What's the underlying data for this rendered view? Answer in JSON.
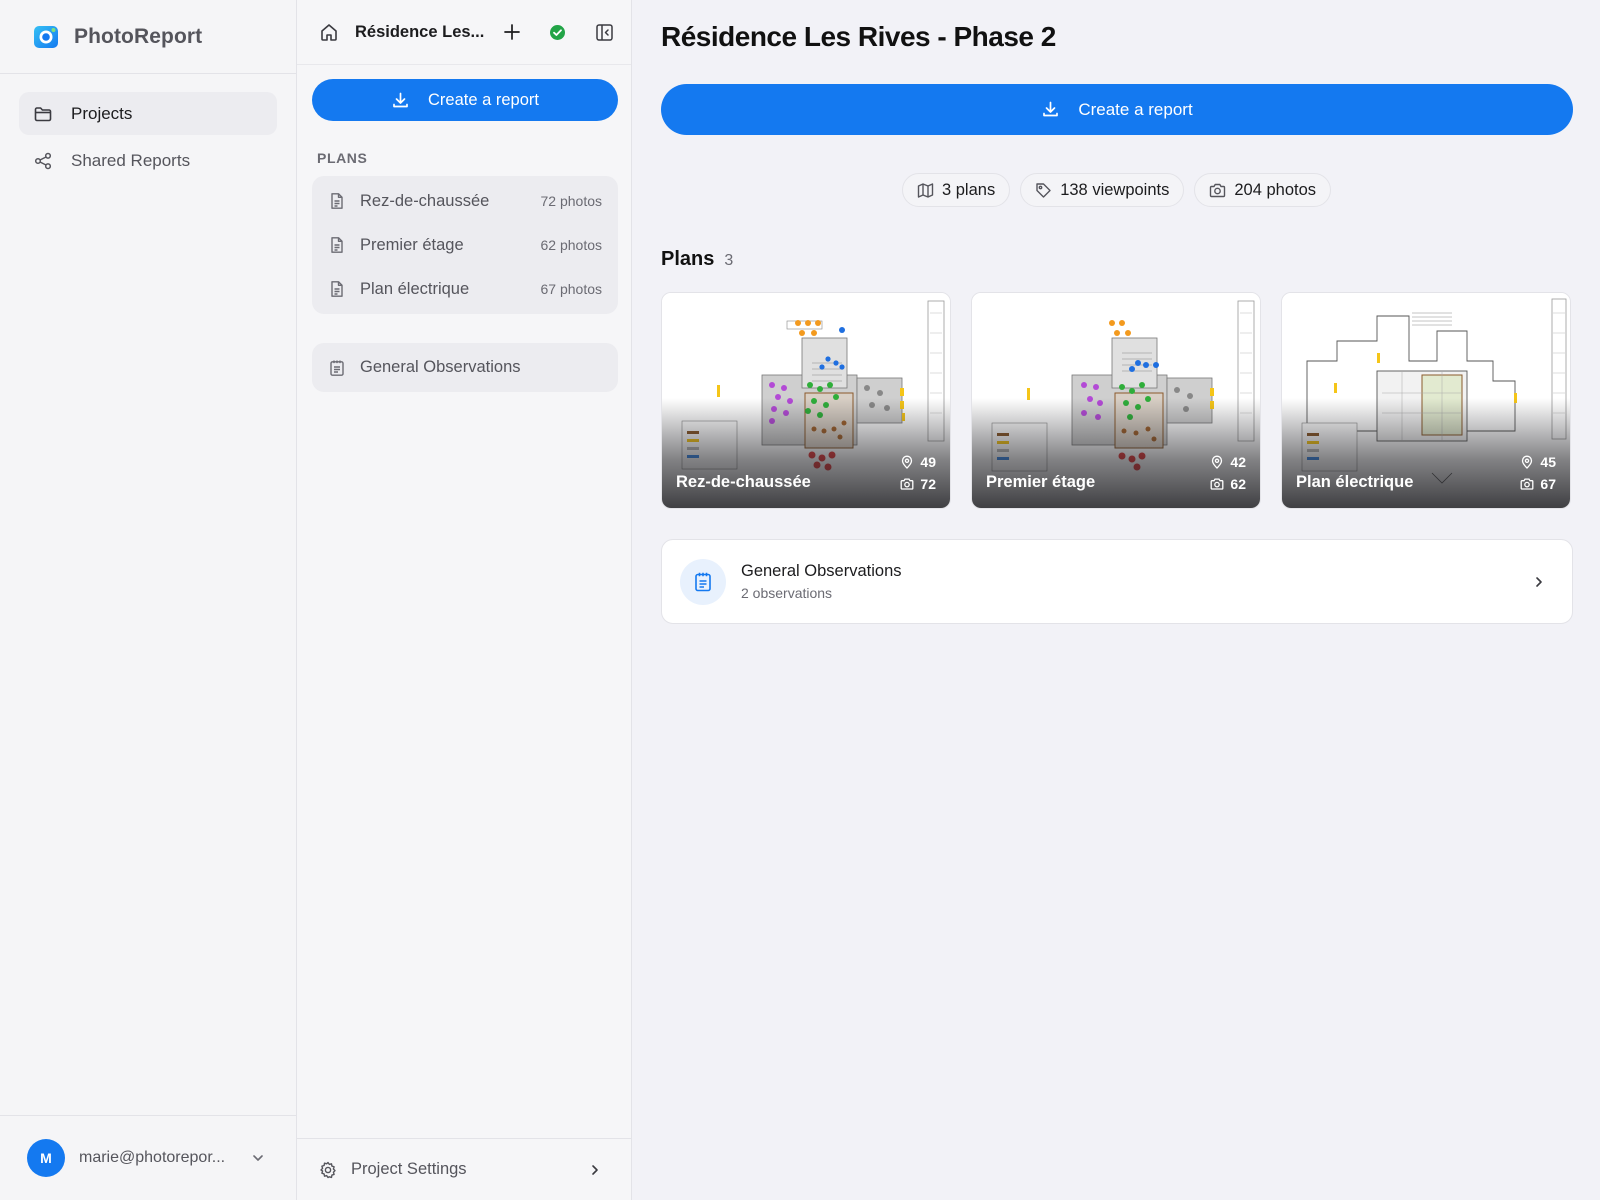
{
  "app": {
    "name": "PhotoReport"
  },
  "sidebar": {
    "items": [
      {
        "label": "Projects",
        "icon": "folder-icon",
        "active": true
      },
      {
        "label": "Shared Reports",
        "icon": "share-icon",
        "active": false
      }
    ],
    "user": {
      "initial": "M",
      "email": "marie@photorepor..."
    }
  },
  "panel": {
    "title": "Résidence Les...",
    "create_report_label": "Create a report",
    "plans_label": "PLANS",
    "plans": [
      {
        "name": "Rez-de-chaussée",
        "count": "72 photos"
      },
      {
        "name": "Premier étage",
        "count": "62 photos"
      },
      {
        "name": "Plan électrique",
        "count": "67 photos"
      }
    ],
    "observations_label": "General Observations",
    "settings_label": "Project Settings"
  },
  "main": {
    "title": "Résidence Les Rives - Phase 2",
    "create_report_label": "Create a report",
    "stats": {
      "plans": "3 plans",
      "viewpoints": "138 viewpoints",
      "photos": "204 photos"
    },
    "plans_heading": "Plans",
    "plans_count": "3",
    "cards": [
      {
        "name": "Rez-de-chaussée",
        "viewpoints": "49",
        "photos": "72"
      },
      {
        "name": "Premier étage",
        "viewpoints": "42",
        "photos": "62"
      },
      {
        "name": "Plan électrique",
        "viewpoints": "45",
        "photos": "67"
      }
    ],
    "observations": {
      "title": "General Observations",
      "subtitle": "2 observations"
    }
  },
  "colors": {
    "accent": "#1479f0",
    "success": "#22a447",
    "background": "#f2f2f7",
    "marker_orange": "#f39a1e",
    "marker_blue": "#1f6fe0",
    "marker_purple": "#b34ad6",
    "marker_green": "#2fae3a",
    "marker_red": "#e03a3a",
    "marker_brown": "#a0622d",
    "marker_yellow": "#f5c518"
  }
}
